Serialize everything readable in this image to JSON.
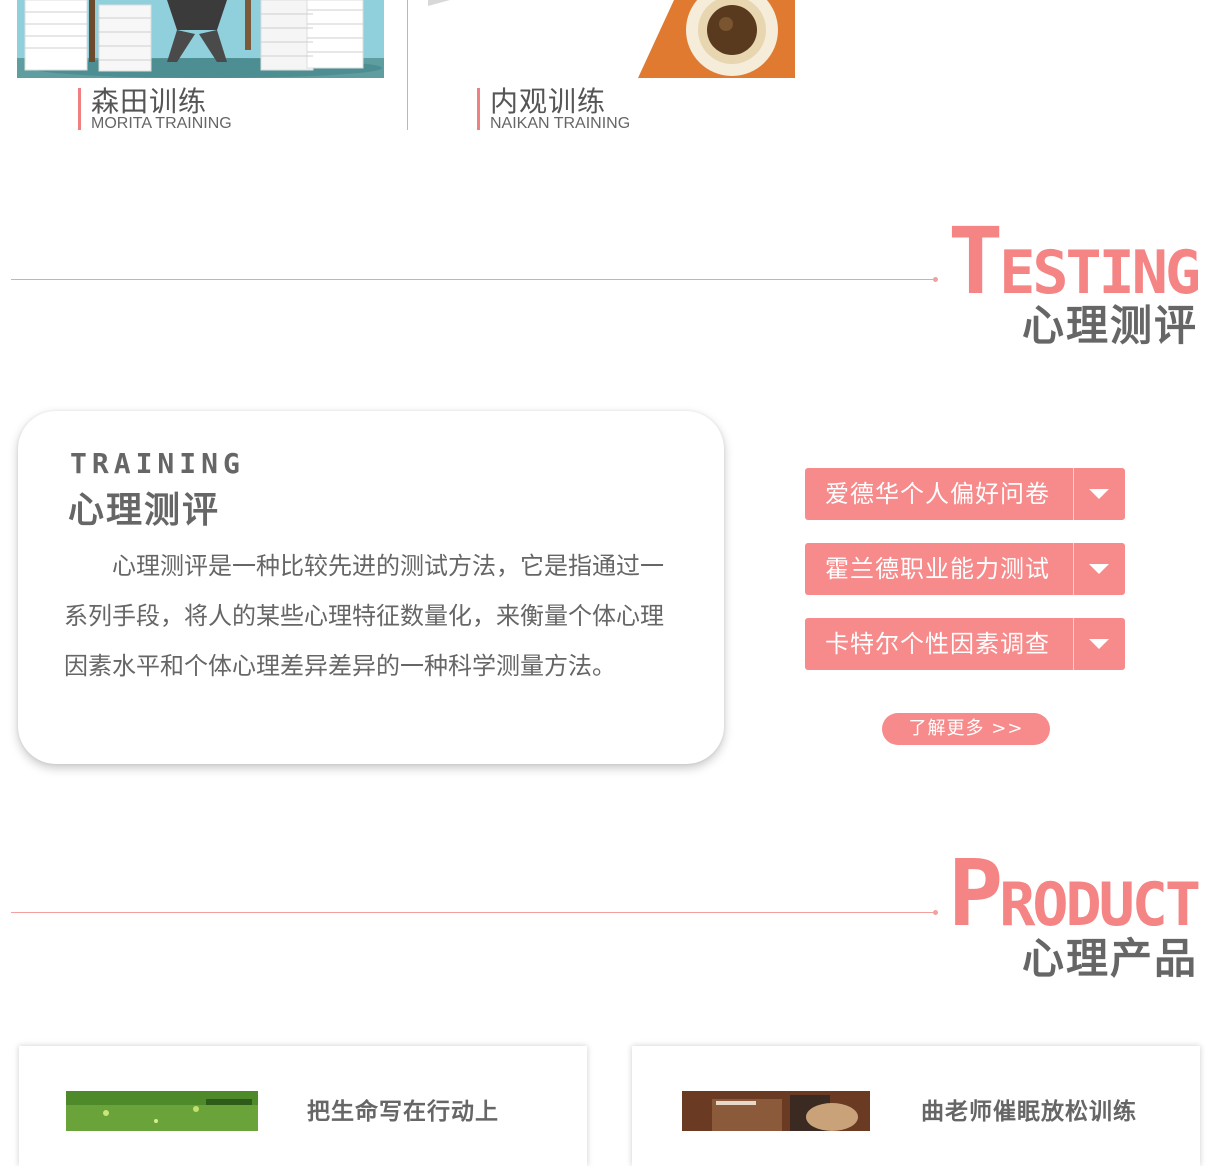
{
  "training_items": [
    {
      "title_zh": "森田训练",
      "title_en": "MORITA TRAINING"
    },
    {
      "title_zh": "内观训练",
      "title_en": "NAIKAN TRAINING"
    }
  ],
  "testing_section": {
    "en_first": "T",
    "en_rest": "ESTING",
    "zh": "心理测评"
  },
  "testing_card": {
    "en": "TRAINING",
    "zh": "心理测评",
    "description": "心理测评是一种比较先进的测试方法，它是指通过一系列手段，将人的某些心理特征数量化，来衡量个体心理因素水平和个体心理差异差异的一种科学测量方法。"
  },
  "tests": [
    {
      "label": "爱德华个人偏好问卷"
    },
    {
      "label": "霍兰德职业能力测试"
    },
    {
      "label": "卡特尔个性因素调查"
    }
  ],
  "more_label": "了解更多 >>",
  "product_section": {
    "en_first": "P",
    "en_rest": "RODUCT",
    "zh": "心理产品"
  },
  "products": [
    {
      "title": "把生命写在行动上"
    },
    {
      "title": "曲老师催眠放松训练"
    }
  ],
  "colors": {
    "accent": "#f78a8a",
    "text": "#666666"
  }
}
